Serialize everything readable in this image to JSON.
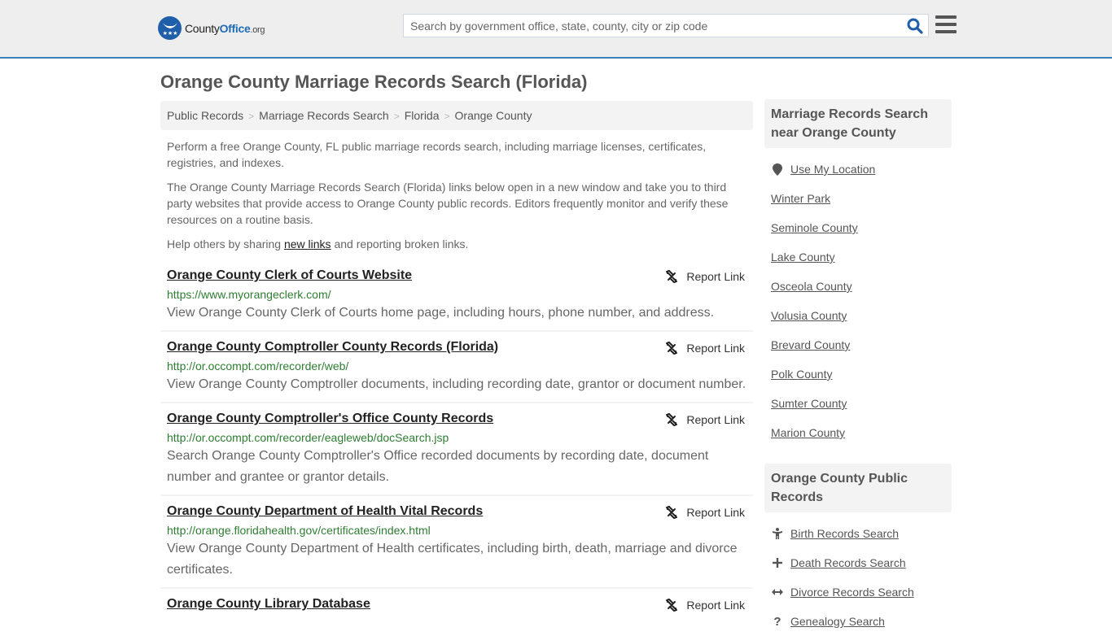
{
  "header": {
    "logo": {
      "county": "County",
      "office": "Office",
      "org": ".org"
    },
    "search_placeholder": "Search by government office, state, county, city or zip code",
    "accent_color": "#3a7fb5"
  },
  "page_title": "Orange County Marriage Records Search (Florida)",
  "breadcrumb": [
    "Public Records",
    "Marriage Records Search",
    "Florida",
    "Orange County"
  ],
  "intro": {
    "p1": "Perform a free Orange County, FL public marriage records search, including marriage licenses, certificates, registries, and indexes.",
    "p2": "The Orange County Marriage Records Search (Florida) links below open in a new window and take you to third party websites that provide access to Orange County public records. Editors frequently monitor and verify these resources on a routine basis.",
    "p3_before": "Help others by sharing ",
    "p3_link": "new links",
    "p3_after": " and reporting broken links."
  },
  "report_label": "Report Link",
  "results": [
    {
      "title": "Orange County Clerk of Courts Website",
      "url": "https://www.myorangeclerk.com/",
      "desc": "View Orange County Clerk of Courts home page, including hours, phone number, and address."
    },
    {
      "title": "Orange County Comptroller County Records (Florida)",
      "url": "http://or.occompt.com/recorder/web/",
      "desc": "View Orange County Comptroller documents, including recording date, grantor or document number."
    },
    {
      "title": "Orange County Comptroller's Office County Records",
      "url": "http://or.occompt.com/recorder/eagleweb/docSearch.jsp",
      "desc": "Search Orange County Comptroller's Office recorded documents by recording date, document number and grantee or grantor details."
    },
    {
      "title": "Orange County Department of Health Vital Records",
      "url": "http://orange.floridahealth.gov/certificates/index.html",
      "desc": "View Orange County Department of Health certificates, including birth, death, marriage and divorce certificates."
    },
    {
      "title": "Orange County Library Database",
      "url": "",
      "desc": ""
    }
  ],
  "sidebar": {
    "nearby_heading": "Marriage Records Search near Orange County",
    "use_location": "Use My Location",
    "nearby": [
      "Winter Park",
      "Seminole County",
      "Lake County",
      "Osceola County",
      "Volusia County",
      "Brevard County",
      "Polk County",
      "Sumter County",
      "Marion County"
    ],
    "public_heading": "Orange County Public Records",
    "public_links": [
      {
        "label": "Birth Records Search",
        "icon": "child-icon"
      },
      {
        "label": "Death Records Search",
        "icon": "plus-icon"
      },
      {
        "label": "Divorce Records Search",
        "icon": "arrows-horizontal-icon"
      },
      {
        "label": "Genealogy Search",
        "icon": "question-icon"
      }
    ]
  }
}
